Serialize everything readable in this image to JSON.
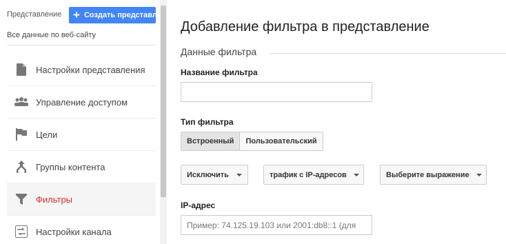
{
  "sidebar": {
    "view_label": "Представление",
    "create_button": "Создать представление",
    "view_name": "Все данные по веб-сайту",
    "items": [
      {
        "label": "Настройки представления",
        "icon": "document-icon"
      },
      {
        "label": "Управление доступом",
        "icon": "people-icon"
      },
      {
        "label": "Цели",
        "icon": "flag-icon"
      },
      {
        "label": "Группы контента",
        "icon": "content-groups-icon"
      },
      {
        "label": "Фильтры",
        "icon": "filter-icon",
        "active": true
      },
      {
        "label": "Настройки канала",
        "icon": "channel-settings-icon"
      }
    ]
  },
  "main": {
    "title": "Добавление фильтра в представление",
    "section": "Данные фильтра",
    "filter_name_label": "Название фильтра",
    "filter_name_value": "",
    "filter_type_label": "Тип фильтра",
    "filter_type_tabs": [
      "Встроенный",
      "Пользовательский"
    ],
    "dropdowns": [
      "Исключить",
      "трафик с IP-адресов",
      "Выберите выражение"
    ],
    "ip_label": "IP-адрес",
    "ip_placeholder": "Пример: 74.125.19.103 или 2001:db8::1 (для"
  },
  "colors": {
    "accent": "#4285f4",
    "active_text": "#d93025"
  }
}
